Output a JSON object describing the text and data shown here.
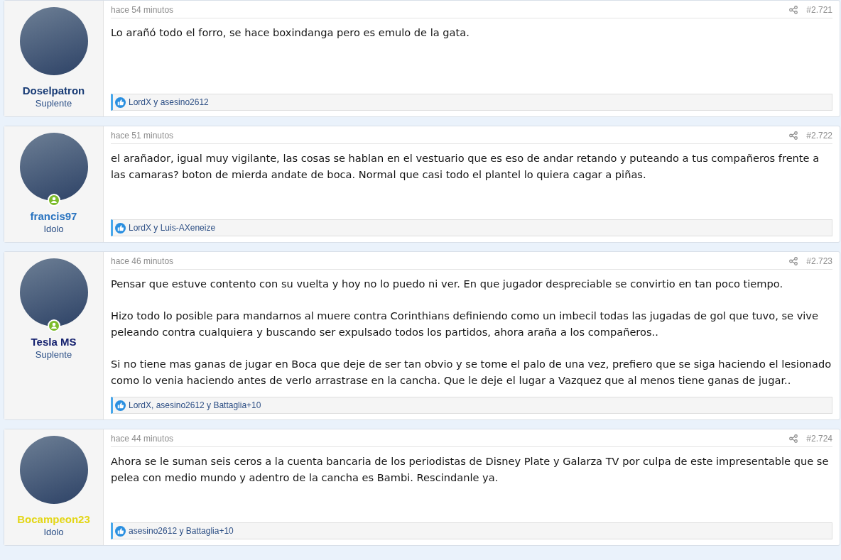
{
  "posts": [
    {
      "user": {
        "name": "Doselpatron",
        "title": "Suplente",
        "color": "#183b75",
        "online": false
      },
      "time": "hace 54 minutos",
      "number": "#2.721",
      "paragraphs": [
        "Lo arañó todo el forro, se hace boxindanga pero es emulo de la gata."
      ],
      "reactions": "LordX y asesino2612"
    },
    {
      "user": {
        "name": "francis97",
        "title": "Idolo",
        "color": "#2a74c0",
        "online": true
      },
      "time": "hace 51 minutos",
      "number": "#2.722",
      "paragraphs": [
        "el arañador, igual muy vigilante, las cosas se hablan en el vestuario que es eso de andar retando y puteando a tus compañeros frente a las camaras? boton de mierda andate de boca. Normal que casi todo el plantel lo quiera cagar a piñas."
      ],
      "reactions": "LordX y Luis-AXeneize"
    },
    {
      "user": {
        "name": "Tesla MS",
        "title": "Suplente",
        "color": "#14206e",
        "online": true
      },
      "time": "hace 46 minutos",
      "number": "#2.723",
      "paragraphs": [
        "Pensar que estuve contento con su vuelta y hoy no lo puedo ni ver. En que jugador despreciable se convirtio en tan poco tiempo.",
        "Hizo todo lo posible para mandarnos al muere contra Corinthians definiendo como un imbecil todas las jugadas de gol que tuvo, se vive peleando contra cualquiera y buscando ser expulsado todos los partidos, ahora araña a los compañeros..",
        "Si no tiene mas ganas de jugar en Boca que deje de ser tan obvio y se tome el palo de una vez, prefiero que se siga haciendo el lesionado como lo venia haciendo antes de verlo arrastrase en la cancha. Que le deje el lugar a Vazquez que al menos tiene ganas de jugar.."
      ],
      "reactions": "LordX, asesino2612 y Battaglia+10"
    },
    {
      "user": {
        "name": "Bocampeon23",
        "title": "Idolo",
        "color": "#e3d616",
        "online": false
      },
      "time": "hace 44 minutos",
      "number": "#2.724",
      "paragraphs": [
        "Ahora se le suman seis ceros a la cuenta bancaria de los periodistas de Disney Plate y Galarza TV por culpa de este impresentable que se pelea con medio mundo y adentro de la cancha es Bambi. Rescindanle ya."
      ],
      "reactions": "asesino2612 y Battaglia+10"
    }
  ]
}
